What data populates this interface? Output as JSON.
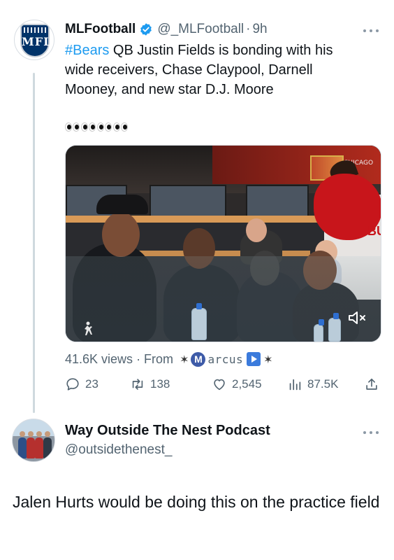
{
  "colors": {
    "link": "#1d9bf0",
    "secondary_text": "#536471",
    "primary_text": "#0f1419",
    "verified": "#1d9bf0"
  },
  "tweet": {
    "author_name": "MLFootball",
    "author_handle": "@_MLFootball",
    "separator": "·",
    "timestamp": "9h",
    "avatar_logo_text": "MFL",
    "verified_icon": "verified-badge-icon",
    "more_icon": "more-options-icon",
    "hashtag": "#Bears",
    "text_line1_rest": " QB Justin Fields is bonding with his",
    "text_line2": "wide receivers, Chase Claypool, Darnell",
    "text_line3": "Mooney, and new star D.J. Moore",
    "emoji_count": 4,
    "media": {
      "mascot_jersey_text": "BU",
      "scoreboard_text": "CHICAGO",
      "mute_icon": "mute-icon"
    },
    "views_text": "41.6K views",
    "from_separator": " · From ",
    "source_star_left": "✶",
    "source_badge_letter": "M",
    "source_name": "arcus",
    "source_star_right": "✶",
    "actions": {
      "reply_count": "23",
      "retweet_count": "138",
      "like_count": "2,545",
      "views_count": "87.5K"
    }
  },
  "reply": {
    "author_name": "Way Outside The Nest Podcast",
    "author_handle": "@outsidethenest_",
    "text": "Jalen Hurts would be doing this on the practice field"
  }
}
